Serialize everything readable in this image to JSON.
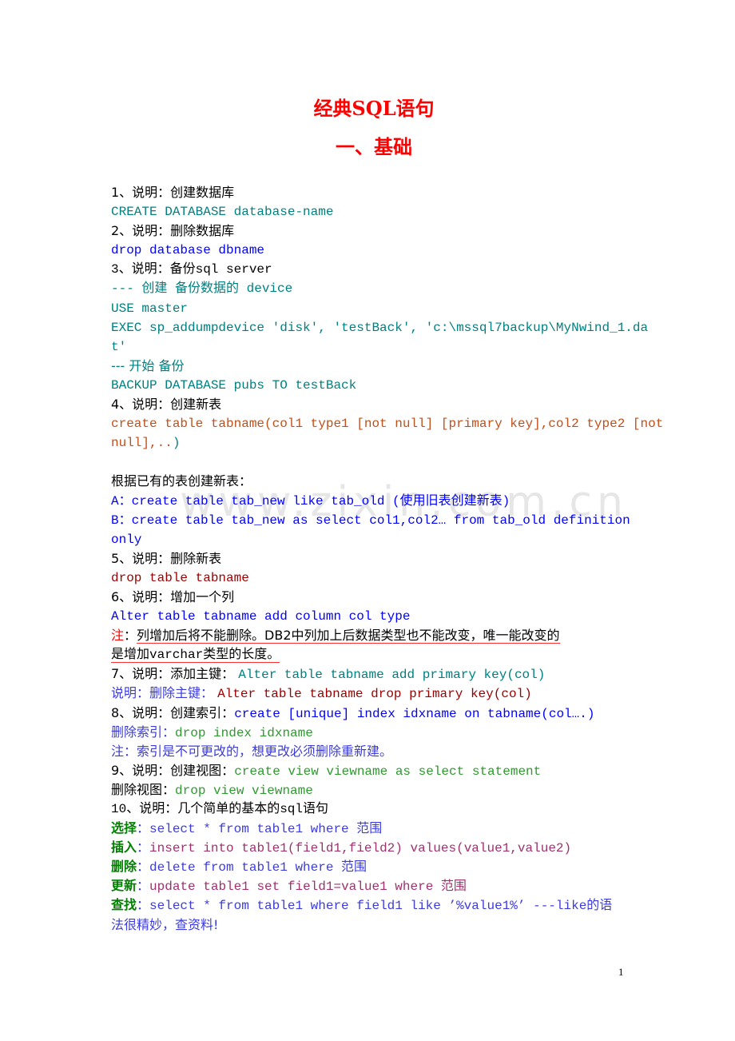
{
  "document": {
    "title": "经典SQL语句",
    "section": "一、基础",
    "watermark": "www.zixin.com.cn",
    "page_number": "1"
  },
  "lines": [
    {
      "segments": [
        {
          "text": "1、说明：创建数据库",
          "style": "black"
        }
      ]
    },
    {
      "segments": [
        {
          "text": "CREATE DATABASE database-name",
          "style": "teal"
        }
      ]
    },
    {
      "segments": [
        {
          "text": "2、说明：删除数据库",
          "style": "black"
        }
      ]
    },
    {
      "segments": [
        {
          "text": "drop database dbname",
          "style": "blue"
        }
      ]
    },
    {
      "segments": [
        {
          "text": "3、说明：备份sql server",
          "style": "black"
        }
      ]
    },
    {
      "segments": [
        {
          "text": "--- 创建 备份数据的 device",
          "style": "teal"
        }
      ]
    },
    {
      "segments": [
        {
          "text": "USE master",
          "style": "teal"
        }
      ]
    },
    {
      "segments": [
        {
          "text": "EXEC sp_addumpdevice 'disk', 'testBack', 'c:\\mssql7backup\\MyNwind_1.da",
          "style": "teal"
        }
      ]
    },
    {
      "segments": [
        {
          "text": "t'",
          "style": "teal"
        }
      ]
    },
    {
      "segments": [
        {
          "text": "--- 开始 备份",
          "style": "teal"
        }
      ]
    },
    {
      "segments": [
        {
          "text": "BACKUP DATABASE pubs TO testBack",
          "style": "teal"
        }
      ]
    },
    {
      "segments": [
        {
          "text": "4、说明：创建新表",
          "style": "black"
        }
      ]
    },
    {
      "segments": [
        {
          "text": "create table tabname(col1 type1 [not null] [primary key],col2 type2 [not",
          "style": "brown"
        }
      ]
    },
    {
      "segments": [
        {
          "text": "null],..",
          "style": "brown"
        },
        {
          "text": ")",
          "style": "teal"
        }
      ]
    },
    {
      "segments": []
    },
    {
      "segments": [
        {
          "text": "根据已有的表创建新表：",
          "style": "black"
        }
      ]
    },
    {
      "segments": [
        {
          "text": "A：create table tab_new like tab_old (使用旧表创建新表)",
          "style": "blue"
        }
      ]
    },
    {
      "segments": [
        {
          "text": "B：create table tab_new as select col1,col2… from tab_old definition",
          "style": "blue"
        }
      ]
    },
    {
      "segments": [
        {
          "text": "only",
          "style": "blue"
        }
      ]
    },
    {
      "segments": [
        {
          "text": "5、说明：删除新表",
          "style": "black"
        }
      ]
    },
    {
      "segments": [
        {
          "text": "drop table tabname",
          "style": "darkred"
        }
      ]
    },
    {
      "segments": [
        {
          "text": "6、说明：增加一个列",
          "style": "black"
        }
      ]
    },
    {
      "segments": [
        {
          "text": "Alter table tabname add column col type",
          "style": "blue"
        }
      ]
    },
    {
      "segments": [
        {
          "text": "注",
          "style": "red"
        },
        {
          "text": "：",
          "style": "black"
        },
        {
          "text": "列增加后将不能删除。DB2中列加上后数据类型也不能改变，唯一能改变的",
          "style": "black-ul"
        }
      ]
    },
    {
      "segments": [
        {
          "text": "是增加varchar类型的长度。",
          "style": "black-ul"
        }
      ]
    },
    {
      "segments": [
        {
          "text": "7、说明：添加主键： ",
          "style": "black"
        },
        {
          "text": "Alter table tabname add primary key(col)",
          "style": "teal"
        }
      ]
    },
    {
      "segments": [
        {
          "text": "说明：删除主键： ",
          "style": "lblue"
        },
        {
          "text": "Alter table tabname drop primary key(col)",
          "style": "darkred"
        }
      ]
    },
    {
      "segments": [
        {
          "text": "8、说明：创建索引：",
          "style": "black"
        },
        {
          "text": "create [unique] index idxname on tabname(col….)",
          "style": "blue"
        }
      ]
    },
    {
      "segments": [
        {
          "text": "删除索引：",
          "style": "lblue"
        },
        {
          "text": "drop index idxname",
          "style": "green"
        }
      ]
    },
    {
      "segments": [
        {
          "text": "注：索引是不可更改的，想更改必须删除重新建。",
          "style": "lblue"
        }
      ]
    },
    {
      "segments": [
        {
          "text": "9、说明：创建视图：",
          "style": "black"
        },
        {
          "text": "create view viewname as select statement",
          "style": "green"
        }
      ]
    },
    {
      "segments": [
        {
          "text": "删除视图：",
          "style": "black"
        },
        {
          "text": "drop view viewname",
          "style": "green"
        }
      ]
    },
    {
      "segments": [
        {
          "text": "10、说明：几个简单的基本的sql语句",
          "style": "black"
        }
      ]
    },
    {
      "segments": [
        {
          "text": "选择",
          "style": "dkgreen"
        },
        {
          "text": "：select * from table1 where 范围",
          "style": "lblue"
        }
      ]
    },
    {
      "segments": [
        {
          "text": "插入",
          "style": "dkgreen"
        },
        {
          "text": "：",
          "style": "lblue"
        },
        {
          "text": "insert into table1(field1,field2) values(value1,value2)",
          "style": "plum"
        }
      ]
    },
    {
      "segments": [
        {
          "text": "删除",
          "style": "dkgreen"
        },
        {
          "text": "：delete from table1 where 范围",
          "style": "lblue"
        }
      ]
    },
    {
      "segments": [
        {
          "text": "更新",
          "style": "dkgreen"
        },
        {
          "text": "：",
          "style": "lblue"
        },
        {
          "text": "update table1 set field1=value1 where 范围",
          "style": "plum"
        }
      ]
    },
    {
      "segments": [
        {
          "text": "查找",
          "style": "dkgreen"
        },
        {
          "text": "：select * from table1 where field1 like ’%value1%’ ---like的语",
          "style": "lblue"
        }
      ]
    },
    {
      "segments": [
        {
          "text": "法很精妙，查资料!",
          "style": "lblue"
        }
      ]
    }
  ]
}
